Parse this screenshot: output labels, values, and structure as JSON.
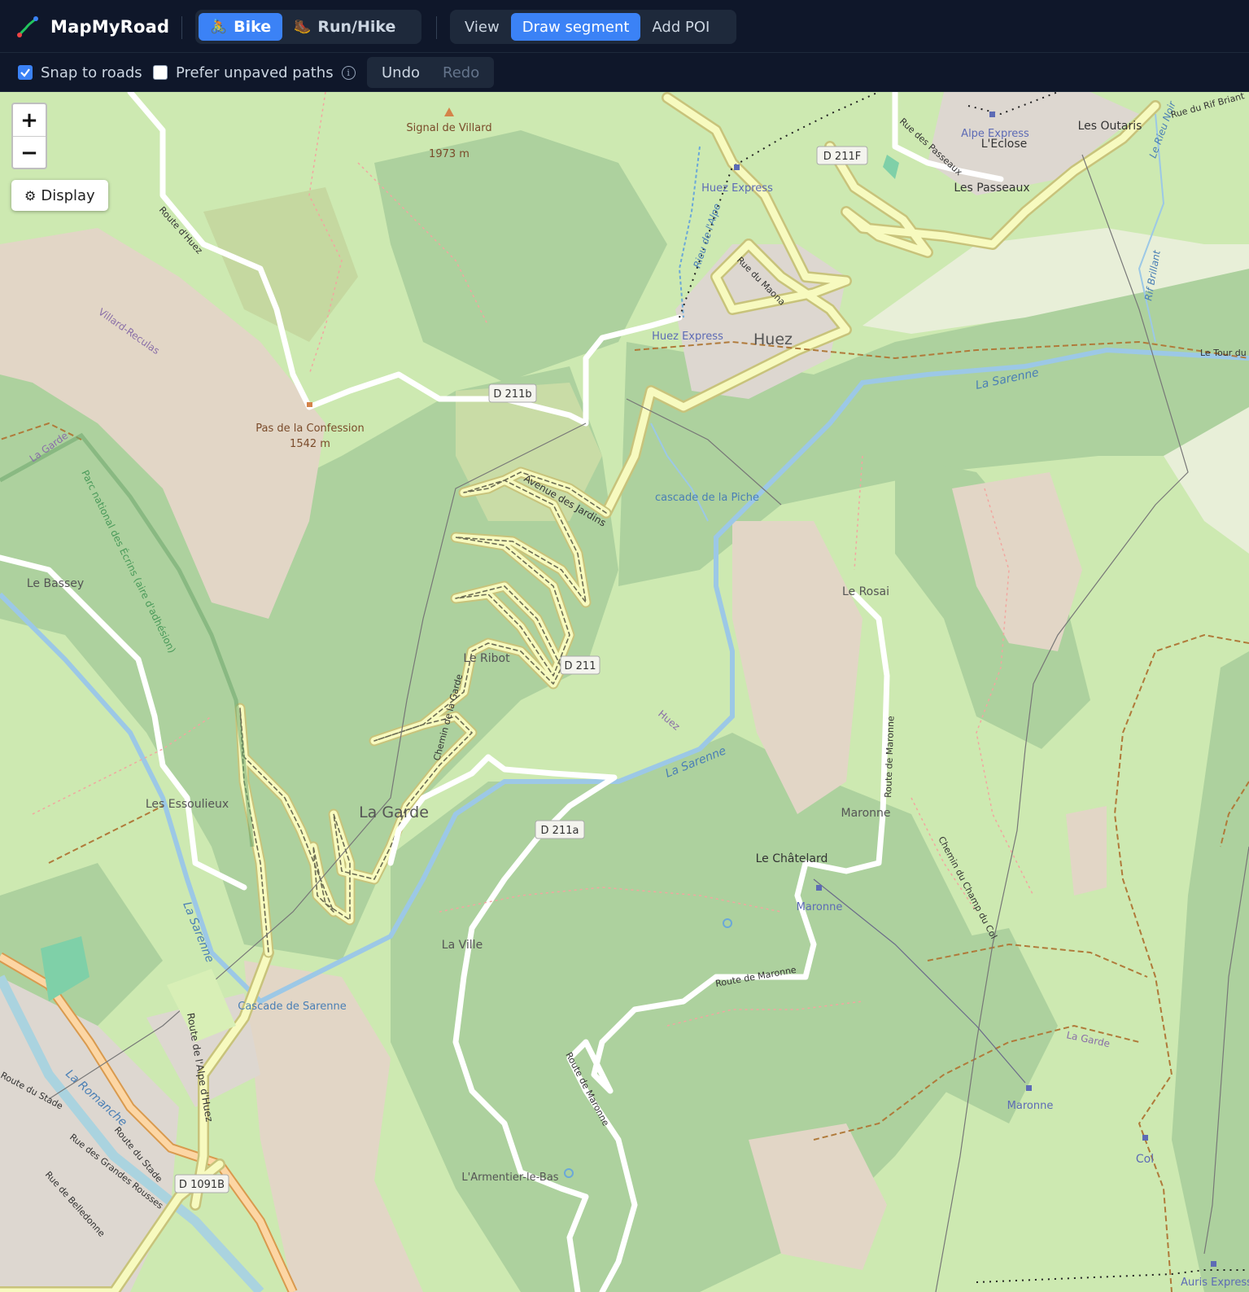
{
  "app": {
    "name": "MapMyRoad"
  },
  "modes": [
    {
      "label": "Bike",
      "icon": "bike-icon",
      "active": true
    },
    {
      "label": "Run/Hike",
      "icon": "boot-icon",
      "active": false
    }
  ],
  "tools": [
    {
      "label": "View",
      "active": false
    },
    {
      "label": "Draw segment",
      "active": true
    },
    {
      "label": "Add POI",
      "active": false
    }
  ],
  "options": {
    "snap_label": "Snap to roads",
    "snap_checked": true,
    "unpaved_label": "Prefer unpaved paths",
    "unpaved_checked": false,
    "info_glyph": "i"
  },
  "history": {
    "undo_label": "Undo",
    "redo_label": "Redo",
    "redo_enabled": false
  },
  "map_controls": {
    "zoom_in": "+",
    "zoom_out": "−",
    "display_label": "Display"
  },
  "map": {
    "road_refs": [
      "D 211b",
      "D 211",
      "D 211F",
      "D 211a",
      "D 1091B"
    ],
    "places": [
      "Huez",
      "La Garde",
      "Le Bassey",
      "Les Essoulieux",
      "Le Ribot",
      "Le Rosai",
      "Maronne",
      "Le Châtelard",
      "La Ville",
      "Les Passeaux",
      "L'Eclose",
      "Les Outaris",
      "Col"
    ],
    "peaks": [
      {
        "name": "Signal de Villard",
        "elevation": "1973 m"
      },
      {
        "name": "Pas de la Confession",
        "elevation": "1542 m"
      }
    ],
    "lifts": [
      "Huez Express",
      "Huez Express",
      "Alpe Express",
      "Maronne",
      "Maronne",
      "Auris Express"
    ],
    "waterfalls": [
      "cascade de la Piche",
      "Cascade de Sarenne"
    ],
    "streams": [
      "La Sarenne",
      "Rieu de l'Alpe",
      "Rif Brillant",
      "Le Rieu Noir"
    ],
    "streets": [
      "Route d'Huez",
      "Avenue des Jardins",
      "Chemin de la Garde",
      "Route de Maronne",
      "Route de Maronne",
      "Route de Maronne",
      "Chemin du Champ du Col",
      "Rue des Passeaux",
      "Rue du Maona",
      "Route de l'Alpe d'Huez",
      "Rue de Belledonne",
      "Rue des Grandes Rousses",
      "Route du Stade",
      "Rue du Rif Briant"
    ],
    "other_labels": [
      "Villard-Reculas",
      "Parc national des Écrins (aire d'adhésion)",
      "La Romanche",
      "L'Armentier-le-Bas",
      "Le Tour du"
    ]
  }
}
